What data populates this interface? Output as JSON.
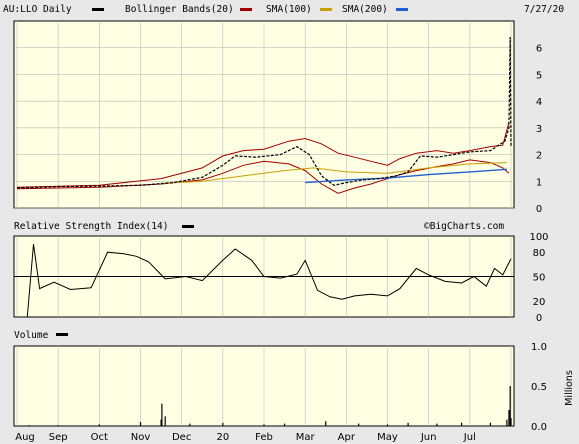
{
  "chart_data": [
    {
      "type": "line",
      "panel": "price",
      "header": {
        "symbol_label": "AU:LLO Daily",
        "indicators": [
          {
            "label": "Bollinger Bands(20)",
            "color": "#a00000"
          },
          {
            "label": "SMA(100)",
            "color": "#c8a000"
          },
          {
            "label": "SMA(200)",
            "color": "#2060d0"
          }
        ],
        "date": "7/27/20"
      },
      "ylim": [
        0,
        7
      ],
      "yticks": [
        0,
        1,
        2,
        3,
        4,
        5,
        6
      ],
      "grid": true,
      "x": [
        "Aug",
        "Sep",
        "Oct",
        "Nov",
        "Dec",
        "20",
        "Feb",
        "Mar",
        "Apr",
        "May",
        "Jun",
        "Jul"
      ],
      "series": [
        {
          "name": "AU:LLO Daily",
          "color": "#000000",
          "points": [
            [
              0,
              0.75
            ],
            [
              1,
              0.8
            ],
            [
              2,
              0.82
            ],
            [
              3,
              0.85
            ],
            [
              3.8,
              0.95
            ],
            [
              4.5,
              1.15
            ],
            [
              5.0,
              1.6
            ],
            [
              5.3,
              1.95
            ],
            [
              5.8,
              1.9
            ],
            [
              6.4,
              2.0
            ],
            [
              6.8,
              2.3
            ],
            [
              7.1,
              2.0
            ],
            [
              7.4,
              1.2
            ],
            [
              7.7,
              0.85
            ],
            [
              8.0,
              0.95
            ],
            [
              8.4,
              1.05
            ],
            [
              8.8,
              1.1
            ],
            [
              9.2,
              1.2
            ],
            [
              9.5,
              1.35
            ],
            [
              9.8,
              1.95
            ],
            [
              10.2,
              1.9
            ],
            [
              10.6,
              2.0
            ],
            [
              11.0,
              2.1
            ],
            [
              11.5,
              2.15
            ],
            [
              11.85,
              2.5
            ],
            [
              11.95,
              3.0
            ],
            [
              11.98,
              6.4
            ],
            [
              12.0,
              2.3
            ]
          ]
        },
        {
          "name": "Bollinger Bands(20)",
          "color": "#a00000",
          "upper": [
            [
              0,
              0.78
            ],
            [
              2,
              0.85
            ],
            [
              3.5,
              1.1
            ],
            [
              4.5,
              1.5
            ],
            [
              5.0,
              1.95
            ],
            [
              5.5,
              2.15
            ],
            [
              6.0,
              2.2
            ],
            [
              6.6,
              2.5
            ],
            [
              7.0,
              2.6
            ],
            [
              7.4,
              2.4
            ],
            [
              7.8,
              2.05
            ],
            [
              8.2,
              1.9
            ],
            [
              8.6,
              1.75
            ],
            [
              9.0,
              1.6
            ],
            [
              9.3,
              1.85
            ],
            [
              9.7,
              2.05
            ],
            [
              10.2,
              2.15
            ],
            [
              10.6,
              2.05
            ],
            [
              11.0,
              2.15
            ],
            [
              11.5,
              2.3
            ],
            [
              11.8,
              2.35
            ],
            [
              11.95,
              3.2
            ]
          ],
          "lower": [
            [
              0,
              0.72
            ],
            [
              2,
              0.78
            ],
            [
              3.5,
              0.9
            ],
            [
              4.5,
              1.05
            ],
            [
              5.0,
              1.3
            ],
            [
              5.5,
              1.6
            ],
            [
              6.0,
              1.75
            ],
            [
              6.6,
              1.65
            ],
            [
              7.0,
              1.4
            ],
            [
              7.4,
              0.9
            ],
            [
              7.8,
              0.55
            ],
            [
              8.2,
              0.75
            ],
            [
              8.6,
              0.9
            ],
            [
              9.0,
              1.1
            ],
            [
              9.3,
              1.25
            ],
            [
              9.7,
              1.4
            ],
            [
              10.2,
              1.55
            ],
            [
              10.6,
              1.65
            ],
            [
              11.0,
              1.8
            ],
            [
              11.5,
              1.7
            ],
            [
              11.8,
              1.5
            ],
            [
              11.95,
              1.3
            ]
          ]
        },
        {
          "name": "SMA(100)",
          "color": "#c8a000",
          "points": [
            [
              3.5,
              0.92
            ],
            [
              4.5,
              1.0
            ],
            [
              5.5,
              1.2
            ],
            [
              6.5,
              1.4
            ],
            [
              7.2,
              1.5
            ],
            [
              8.0,
              1.35
            ],
            [
              9.0,
              1.3
            ],
            [
              10.0,
              1.5
            ],
            [
              11.0,
              1.65
            ],
            [
              11.9,
              1.7
            ]
          ]
        },
        {
          "name": "SMA(200)",
          "color": "#2060d0",
          "points": [
            [
              7.0,
              0.95
            ],
            [
              8.0,
              1.05
            ],
            [
              9.0,
              1.12
            ],
            [
              10.0,
              1.25
            ],
            [
              11.0,
              1.35
            ],
            [
              11.9,
              1.45
            ]
          ]
        }
      ]
    },
    {
      "type": "line",
      "panel": "rsi",
      "header": {
        "label": "Relative Strength Index(14)",
        "watermark": "©BigCharts.com"
      },
      "ylim": [
        0,
        100
      ],
      "yticks": [
        0,
        20,
        50,
        80,
        100
      ],
      "reference_line": 50,
      "series": [
        {
          "name": "Relative Strength Index(14)",
          "color": "#000000",
          "points": [
            [
              0,
              0
            ],
            [
              0.25,
              0
            ],
            [
              0.4,
              90
            ],
            [
              0.55,
              35
            ],
            [
              0.9,
              43
            ],
            [
              1.3,
              34
            ],
            [
              1.8,
              36
            ],
            [
              2.2,
              80
            ],
            [
              2.6,
              78
            ],
            [
              2.9,
              75
            ],
            [
              3.2,
              68
            ],
            [
              3.6,
              47
            ],
            [
              4.1,
              50
            ],
            [
              4.5,
              45
            ],
            [
              5.0,
              70
            ],
            [
              5.3,
              84
            ],
            [
              5.7,
              70
            ],
            [
              6.0,
              50
            ],
            [
              6.4,
              48
            ],
            [
              6.8,
              53
            ],
            [
              7.0,
              70
            ],
            [
              7.3,
              33
            ],
            [
              7.6,
              25
            ],
            [
              7.9,
              22
            ],
            [
              8.2,
              26
            ],
            [
              8.6,
              28
            ],
            [
              9.0,
              26
            ],
            [
              9.3,
              35
            ],
            [
              9.7,
              60
            ],
            [
              10.0,
              52
            ],
            [
              10.4,
              44
            ],
            [
              10.8,
              42
            ],
            [
              11.1,
              50
            ],
            [
              11.4,
              38
            ],
            [
              11.6,
              60
            ],
            [
              11.8,
              52
            ],
            [
              12.0,
              72
            ]
          ]
        }
      ]
    },
    {
      "type": "bar",
      "panel": "volume",
      "header": {
        "label": "Volume"
      },
      "ylim": [
        0,
        1.0
      ],
      "yticks": [
        "0.0",
        "0.5",
        "1.0"
      ],
      "ylabel": "Millions",
      "values": [
        [
          0.3,
          0.01
        ],
        [
          1.0,
          0.01
        ],
        [
          2.0,
          0.02
        ],
        [
          3.0,
          0.05
        ],
        [
          3.5,
          0.08
        ],
        [
          3.52,
          0.28
        ],
        [
          3.6,
          0.12
        ],
        [
          4.2,
          0.03
        ],
        [
          5.0,
          0.04
        ],
        [
          6.0,
          0.02
        ],
        [
          6.5,
          0.03
        ],
        [
          7.5,
          0.06
        ],
        [
          8.3,
          0.03
        ],
        [
          9.0,
          0.02
        ],
        [
          9.5,
          0.04
        ],
        [
          10.2,
          0.03
        ],
        [
          10.8,
          0.04
        ],
        [
          11.5,
          0.04
        ],
        [
          11.9,
          0.08
        ],
        [
          11.95,
          0.2
        ],
        [
          11.98,
          0.5
        ],
        [
          12.0,
          0.1
        ]
      ]
    }
  ],
  "xaxis_labels": [
    "Aug",
    "Sep",
    "Oct",
    "Nov",
    "Dec",
    "20",
    "Feb",
    "Mar",
    "Apr",
    "May",
    "Jun",
    "Jul"
  ]
}
